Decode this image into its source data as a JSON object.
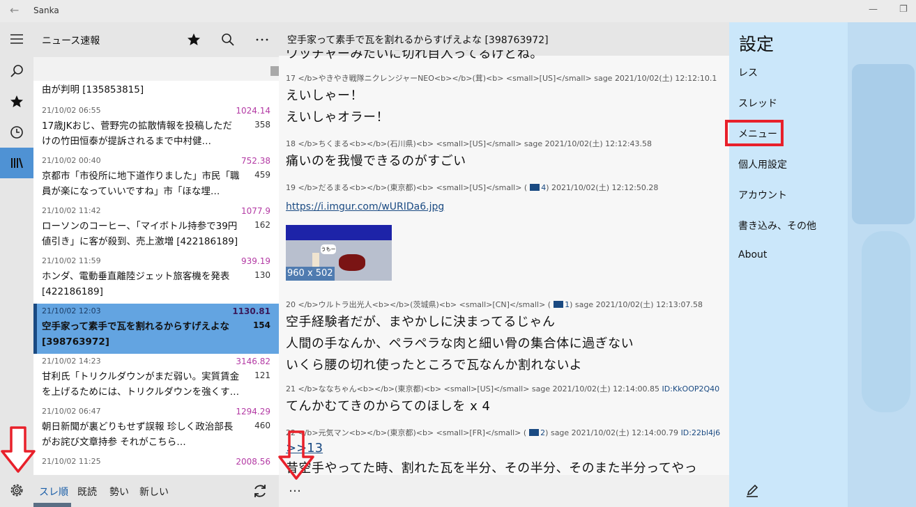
{
  "window": {
    "title": "Sanka"
  },
  "rail": {
    "icons": [
      "hamburger-icon",
      "search-icon",
      "star-icon",
      "history-icon",
      "library-icon"
    ],
    "active": "library-icon"
  },
  "list_header": {
    "board": "ニュース速報"
  },
  "threads": [
    {
      "title": "由が判明 [135853815]"
    },
    {
      "date": "21/10/02 06:55",
      "score": "1024.14",
      "count": "358",
      "title": "17歳JKおじ、菅野完の拡散情報を投稿しただけの竹田恒泰が提訴されるまで中村健…"
    },
    {
      "date": "21/10/02 00:40",
      "score": "752.38",
      "count": "459",
      "title": "京都市「市役所に地下道作りました」市民「職員が楽になっていいですね」市「ほな埋…"
    },
    {
      "date": "21/10/02 11:42",
      "score": "1077.9",
      "count": "162",
      "title": "ローソンのコーヒー、「マイボトル持参で39円値引き」に客が殺到、売上激増 [422186189]"
    },
    {
      "date": "21/10/02 11:59",
      "score": "939.19",
      "count": "130",
      "title": "ホンダ、電動垂直離陸ジェット旅客機を発表 [422186189]"
    },
    {
      "date": "21/10/02 12:03",
      "score": "1130.81",
      "count": "154",
      "title": "空手家って素手で瓦を割れるからすげえよな [398763972]",
      "selected": true
    },
    {
      "date": "21/10/02 14:23",
      "score": "3146.82",
      "count": "121",
      "title": "甘利氏「トリクルダウンがまだ弱い。実質賃金を上げるためには、トリクルダウンを強くす…"
    },
    {
      "date": "21/10/02 06:47",
      "score": "1294.29",
      "count": "460",
      "title": "朝日新聞が裏どりもせず誤報 珍しく政治部長がお詫び文章持参 それがこちら…"
    },
    {
      "date": "21/10/02 11:25",
      "score": "2008.56",
      "count": "",
      "title": ""
    }
  ],
  "list_footer": {
    "sort": [
      "スレ順",
      "既読",
      "勢い",
      "新しい"
    ],
    "active_sort": "スレ順"
  },
  "content": {
    "title": "空手家って素手で瓦を割れるからすげえよな [398763972]",
    "top_partial": "ワッチャーみたいに切れ目入ってるけどね。",
    "posts": [
      {
        "meta": "17 </b>やきやき戦隊ニクレンジャーNEO<b></b>(茸)<b> <small>[US]</small> sage 2021/10/02(土) 12:12:10.1",
        "lines": [
          "えいしゃー！",
          "えいしゃオラー！"
        ]
      },
      {
        "meta": "18 </b>ちくまる<b></b>(石川県)<b> <small>[US]</small> sage 2021/10/02(土) 12:12:43.58",
        "lines": [
          "痛いのを我慢できるのがすごい"
        ]
      },
      {
        "meta_pre": "19 </b>だるまる<b></b>(東京都)<b> <small>[US]</small> (",
        "replies": "4",
        "meta_post": ") 2021/10/02(土) 12:12:50.28",
        "link": "https://i.imgur.com/wURIDa6.jpg",
        "thumb": {
          "label": "960 x 502",
          "bubble": "うもー"
        }
      },
      {
        "meta_pre": "20 </b>ウルトラ出光人<b></b>(茨城県)<b> <small>[CN]</small> (",
        "replies": "1",
        "meta_post": ") sage 2021/10/02(土) 12:13:07.58",
        "lines": [
          "空手経験者だが、まやかしに決まってるじゃん",
          "人間の手なんか、ペラペラな肉と細い骨の集合体に過ぎない",
          "いくら腰の切れ使ったところで瓦なんか割れないよ"
        ]
      },
      {
        "meta": "21 </b>ななちゃん<b></b>(東京都)<b> <small>[US]</small> sage 2021/10/02(土) 12:14:00.85",
        "id": "ID:KkOOP2Q40",
        "lines": [
          "てんかむてきのからてのほしを x 4"
        ]
      },
      {
        "meta_pre": "22 </b>元気マン<b></b>(東京都)<b> <small>[FR]</small> (",
        "replies": "2",
        "meta_post": ") sage 2021/10/02(土) 12:14:00.79",
        "id": "ID:22bl4j6",
        "reply_link": ">>13",
        "lines": [
          "昔空手やってた時、割れた瓦を半分、その半分、そのまた半分ってやっ"
        ]
      }
    ],
    "footer_more": "…"
  },
  "settings": {
    "header": "設定",
    "items": [
      "レス",
      "スレッド",
      "メニュー",
      "個人用設定",
      "アカウント",
      "書き込み、その他",
      "About"
    ],
    "highlighted": "メニュー"
  },
  "colors": {
    "accent": "#4f92d4",
    "selected_row": "#63a4e1",
    "score": "#b33aa4",
    "flyout": "#cbe7fa",
    "annotation": "#e8202a"
  }
}
